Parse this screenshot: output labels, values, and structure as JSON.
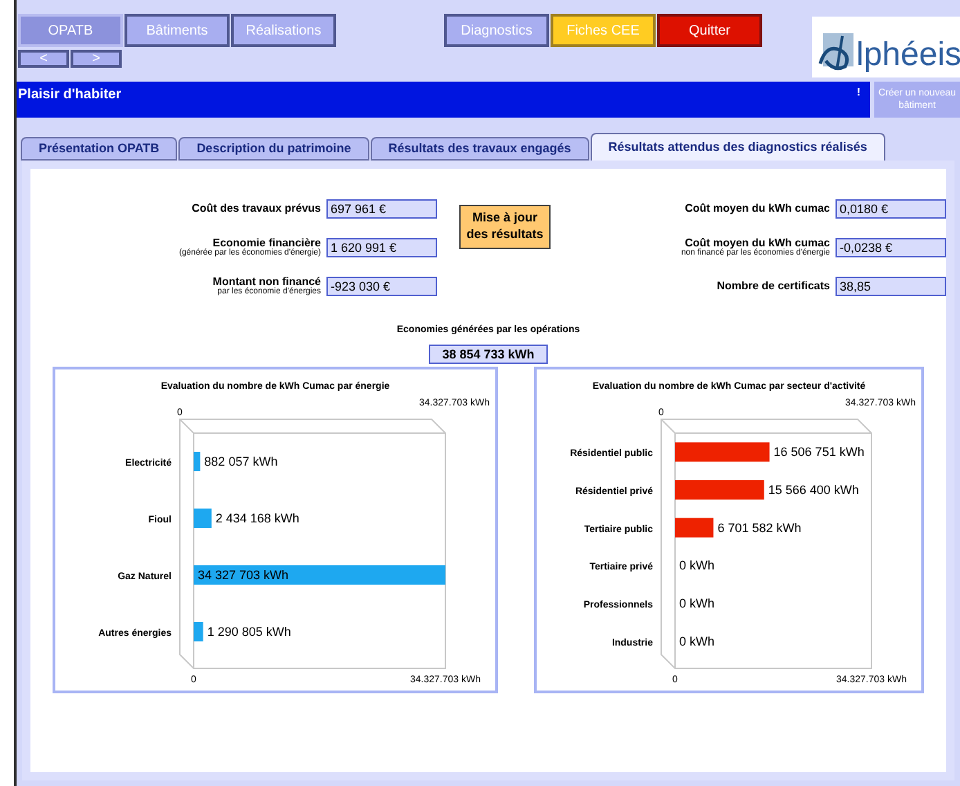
{
  "nav": {
    "buttons": [
      {
        "label": "OPATB",
        "kind": "pale"
      },
      {
        "label": "Bâtiments",
        "kind": "normal"
      },
      {
        "label": "Réalisations",
        "kind": "normal"
      },
      {
        "label": "Diagnostics",
        "kind": "normal"
      },
      {
        "label": "Fiches CEE",
        "kind": "yellow"
      },
      {
        "label": "Quitter",
        "kind": "red"
      }
    ],
    "arrows": [
      "<",
      ">"
    ],
    "logo_text": "lphéeis"
  },
  "title_bar": {
    "title": "Plaisir d'habiter",
    "mark": "!",
    "new_button": "Créer un nouveau bâtiment"
  },
  "tabs": [
    {
      "label": "Présentation OPATB",
      "selected": false
    },
    {
      "label": "Description du patrimoine",
      "selected": false
    },
    {
      "label": "Résultats des travaux engagés",
      "selected": false
    },
    {
      "label": "Résultats attendus des diagnostics réalisés",
      "selected": true
    }
  ],
  "left_fields": [
    {
      "label": "Coût des travaux prévus",
      "value": "697 961 €"
    },
    {
      "label": "Economie financière",
      "sub": "(générée par les économies d'énergie)",
      "value": "1 620 991 €"
    },
    {
      "label": "Montant non financé",
      "sub": "par les économie d'énergies",
      "value": "-923 030 €"
    }
  ],
  "update_button": "Mise à jour des résultats",
  "right_fields": [
    {
      "label": "Coût moyen du kWh cumac",
      "value": "0,0180 €"
    },
    {
      "label": "Coût moyen du kWh cumac",
      "sub": "non financé par les économies d'énergie",
      "value": "-0,0238 €"
    },
    {
      "label": "Nombre de certificats",
      "value": "38,85"
    }
  ],
  "savings": {
    "label": "Economies générées par les opérations",
    "value": "38 854 733 kWh"
  },
  "charts": [
    {
      "top_axis": [
        "0",
        "34.327.703 kWh"
      ],
      "chart_data": {
        "type": "bar",
        "orientation": "horizontal",
        "title": "Evaluation du nombre de kWh Cumac par énergie",
        "categories": [
          "Electricité",
          "Fioul",
          "Gaz Naturel",
          "Autres énergies"
        ],
        "series": [
          {
            "color": "#1ea8f0",
            "values": [
              882057,
              2434168,
              34327703,
              1290805
            ]
          }
        ],
        "value_labels": [
          "882 057 kWh",
          "2 434 168 kWh",
          "34 327 703 kWh",
          "1 290 805 kWh"
        ],
        "xlim": [
          0,
          34327703
        ],
        "xticks": [
          0,
          {
            "value": 34327703,
            "label": "34.327.703 kWh"
          }
        ]
      }
    },
    {
      "top_axis": [
        "0",
        "34.327.703 kWh"
      ],
      "chart_data": {
        "type": "bar",
        "orientation": "horizontal",
        "title": "Evaluation du nombre de kWh Cumac par secteur d'activité",
        "categories": [
          "Résidentiel public",
          "Résidentiel privé",
          "Tertiaire public",
          "Tertiaire privé",
          "Professionnels",
          "Industrie"
        ],
        "series": [
          {
            "color": "#ee2200",
            "values": [
              16506751,
              15566400,
              6701582,
              0,
              0,
              0
            ]
          }
        ],
        "value_labels": [
          "16 506 751 kWh",
          "15 566 400 kWh",
          "6 701 582 kWh",
          "0 kWh",
          "0 kWh",
          "0 kWh"
        ],
        "xlim": [
          0,
          34327703
        ],
        "xticks": [
          0,
          {
            "value": 34327703,
            "label": "34.327.703 kWh"
          }
        ]
      }
    }
  ]
}
